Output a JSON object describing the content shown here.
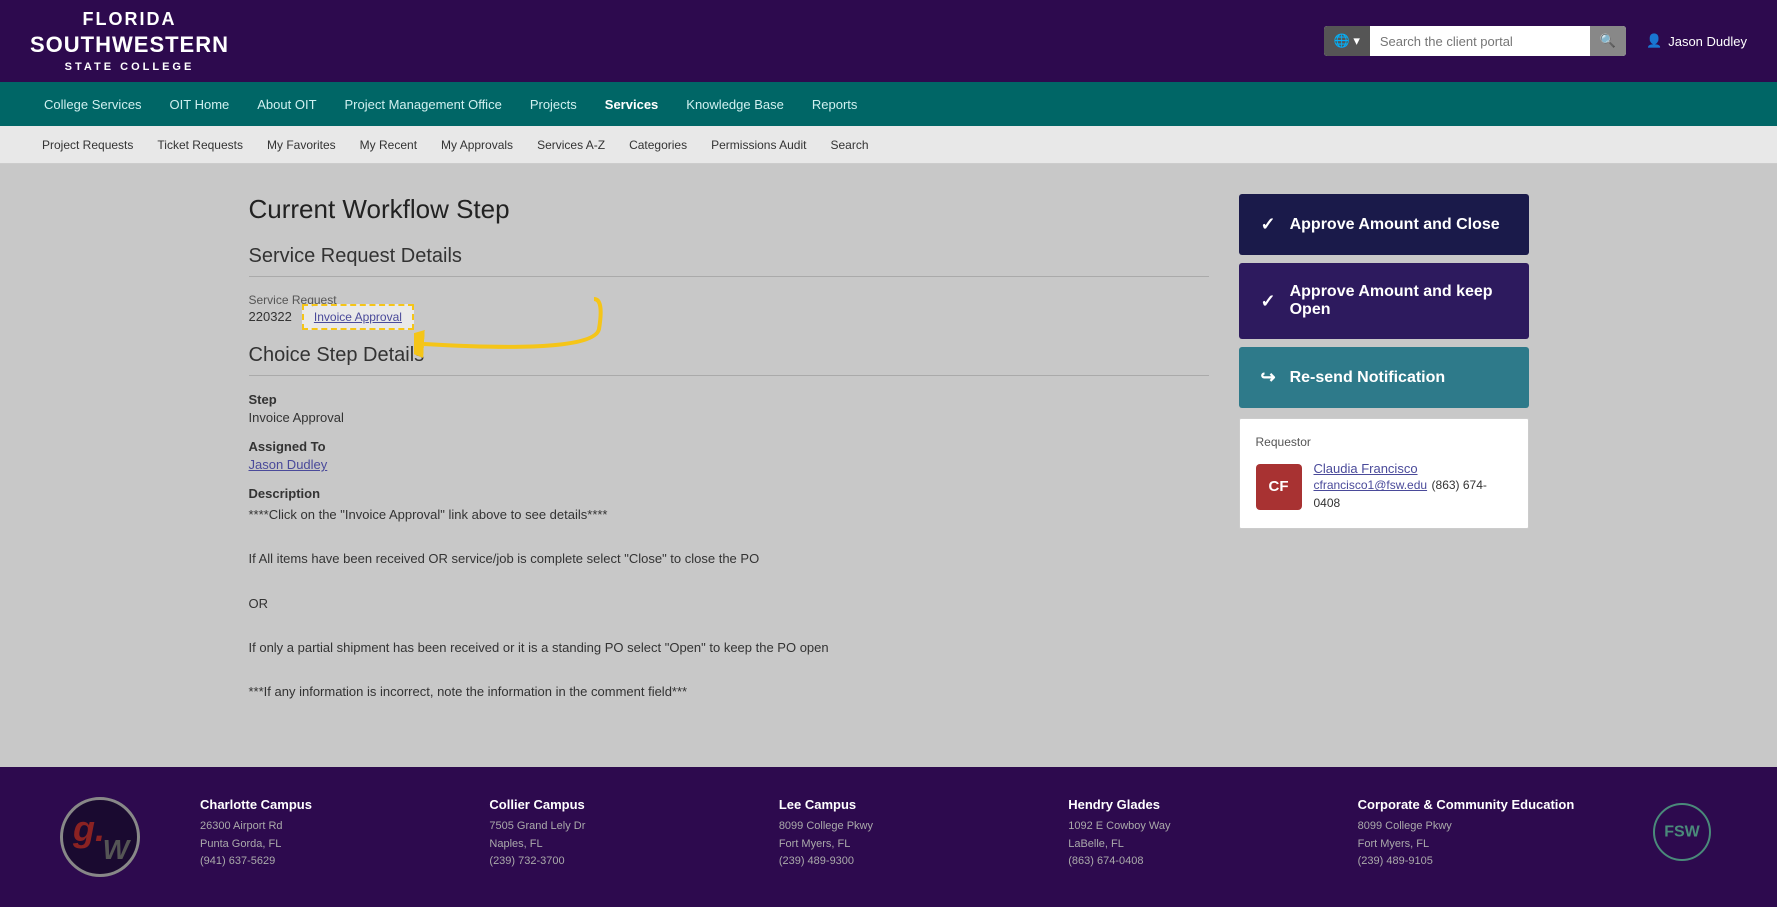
{
  "header": {
    "logo_line1": "FLORIDA",
    "logo_line2": "SOUTHWESTERN",
    "logo_line3": "STATE COLLEGE",
    "search_placeholder": "Search the client portal",
    "user_name": "Jason Dudley"
  },
  "nav_primary": {
    "items": [
      {
        "label": "College Services",
        "active": false
      },
      {
        "label": "OIT Home",
        "active": false
      },
      {
        "label": "About OIT",
        "active": false
      },
      {
        "label": "Project Management Office",
        "active": false
      },
      {
        "label": "Projects",
        "active": false
      },
      {
        "label": "Services",
        "active": true
      },
      {
        "label": "Knowledge Base",
        "active": false
      },
      {
        "label": "Reports",
        "active": false
      }
    ]
  },
  "nav_secondary": {
    "items": [
      "Project Requests",
      "Ticket Requests",
      "My Favorites",
      "My Recent",
      "My Approvals",
      "Services A-Z",
      "Categories",
      "Permissions Audit",
      "Search"
    ]
  },
  "main": {
    "page_title": "Current Workflow Step",
    "service_request_section": "Service Request Details",
    "service_request_label": "Service Request",
    "service_request_number": "220322",
    "invoice_link_text": "Invoice Approval",
    "choice_step_section": "Choice Step Details",
    "step_label": "Step",
    "step_value": "Invoice Approval",
    "assigned_to_label": "Assigned To",
    "assigned_to_value": "Jason Dudley",
    "description_label": "Description",
    "description_lines": [
      "****Click on the \"Invoice Approval\" link above to see details****",
      "",
      "If All items have been received OR service/job is complete select \"Close\" to close the PO",
      "",
      "OR",
      "",
      "If only a partial shipment has been received or it is a standing PO select \"Open\" to keep the PO open",
      "",
      "***If any information is incorrect, note the information in the comment field***"
    ]
  },
  "actions": {
    "approve_close_label": "Approve Amount and Close",
    "approve_open_label": "Approve Amount and keep Open",
    "resend_label": "Re-send Notification",
    "check_icon": "✓",
    "resend_icon": "↪"
  },
  "requestor": {
    "section_label": "Requestor",
    "initials": "CF",
    "name": "Claudia Francisco",
    "email": "cfrancisco1@fsw.edu",
    "phone": "(863) 674-0408"
  },
  "footer": {
    "campuses": [
      {
        "name": "Charlotte Campus",
        "address": "26300 Airport Rd",
        "city": "Punta Gorda, FL",
        "phone": "(941) 637-5629"
      },
      {
        "name": "Collier Campus",
        "address": "7505 Grand Lely Dr",
        "city": "Naples, FL",
        "phone": "(239) 732-3700"
      },
      {
        "name": "Lee Campus",
        "address": "8099 College Pkwy",
        "city": "Fort Myers, FL",
        "phone": "(239) 489-9300"
      },
      {
        "name": "Hendry Glades",
        "address": "1092 E Cowboy Way",
        "city": "LaBelle, FL",
        "phone": "(863) 674-0408"
      },
      {
        "name": "Corporate & Community Education",
        "address": "8099 College Pkwy",
        "city": "Fort Myers, FL",
        "phone": "(239) 489-9105"
      }
    ]
  }
}
